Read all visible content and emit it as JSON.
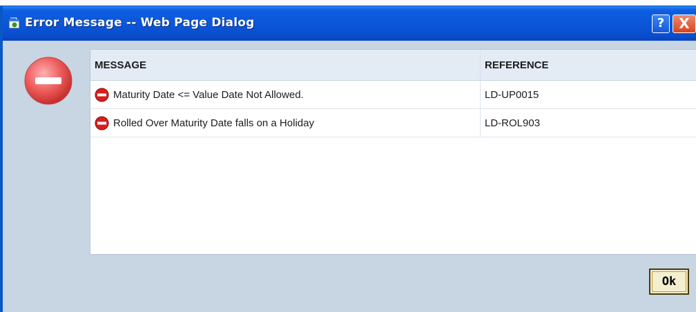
{
  "window": {
    "title": "Error Message -- Web Page Dialog",
    "help_label": "?",
    "close_label": "X"
  },
  "table": {
    "headers": {
      "message": "MESSAGE",
      "reference": "REFERENCE"
    },
    "rows": [
      {
        "message": "Maturity Date <= Value Date Not Allowed.",
        "reference": "LD-UP0015"
      },
      {
        "message": "Rolled Over Maturity Date falls on a Holiday",
        "reference": "LD-ROL903"
      }
    ]
  },
  "actions": {
    "ok_label": "Ok"
  },
  "colors": {
    "title_bar": "#0b55d8",
    "background": "#c8d5e3",
    "error_red": "#d81e1e"
  },
  "icons": {
    "title": "web-dialog-icon",
    "big": "error-circle-icon",
    "row": "stop-icon"
  }
}
